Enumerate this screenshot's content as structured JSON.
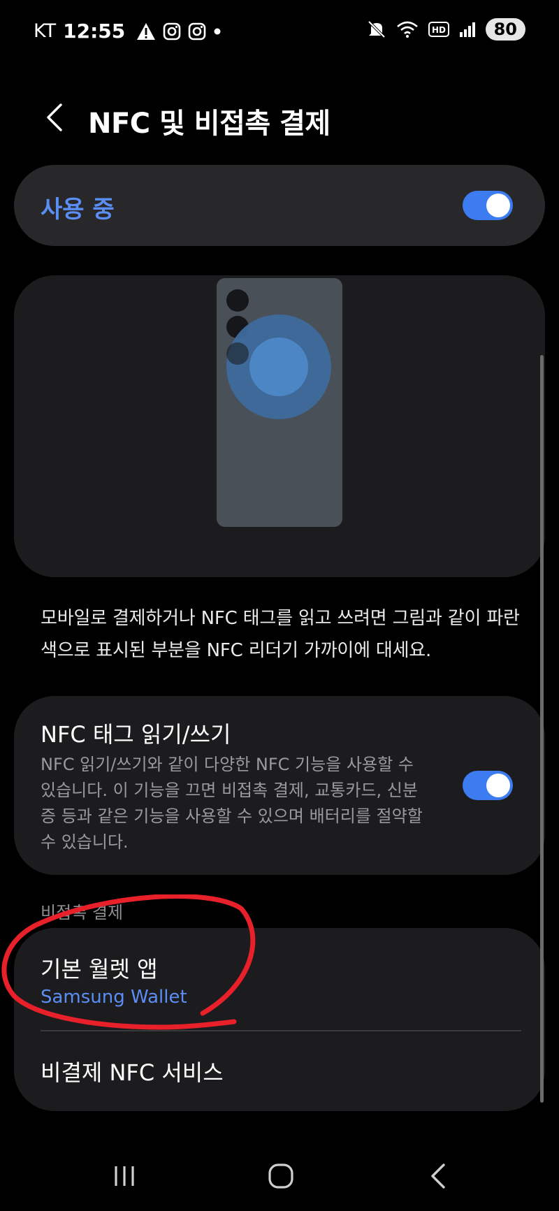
{
  "status_bar": {
    "carrier": "KT",
    "time": "12:55",
    "battery": "80"
  },
  "header": {
    "title": "NFC 및 비접촉 결제"
  },
  "main_toggle": {
    "label": "사용 중",
    "state": "on"
  },
  "description": "모바일로 결제하거나 NFC 태그를 읽고 쓰려면 그림과 같이 파란색으로 표시된 부분을 NFC 리더기 가까이에 대세요.",
  "nfc_tag": {
    "title": "NFC 태그 읽기/쓰기",
    "description": "NFC 읽기/쓰기와 같이 다양한 NFC 기능을 사용할 수 있습니다. 이 기능을 끄면 비접촉 결제, 교통카드, 신분증 등과 같은 기능을 사용할 수 있으며 배터리를 절약할 수 있습니다.",
    "state": "on"
  },
  "contactless_section": {
    "label": "비접촉 결제"
  },
  "wallet": {
    "title": "기본 월렛 앱",
    "value": "Samsung Wallet"
  },
  "non_payment": {
    "title": "비결제 NFC 서비스"
  },
  "colors": {
    "accent": "#5b8ef5",
    "toggle_on": "#3d7cf0",
    "annotation": "#e8202a"
  },
  "icons": {
    "back": "chevron-left-icon",
    "nav_recents": "recents-icon",
    "nav_home": "home-icon",
    "nav_back": "back-icon"
  }
}
